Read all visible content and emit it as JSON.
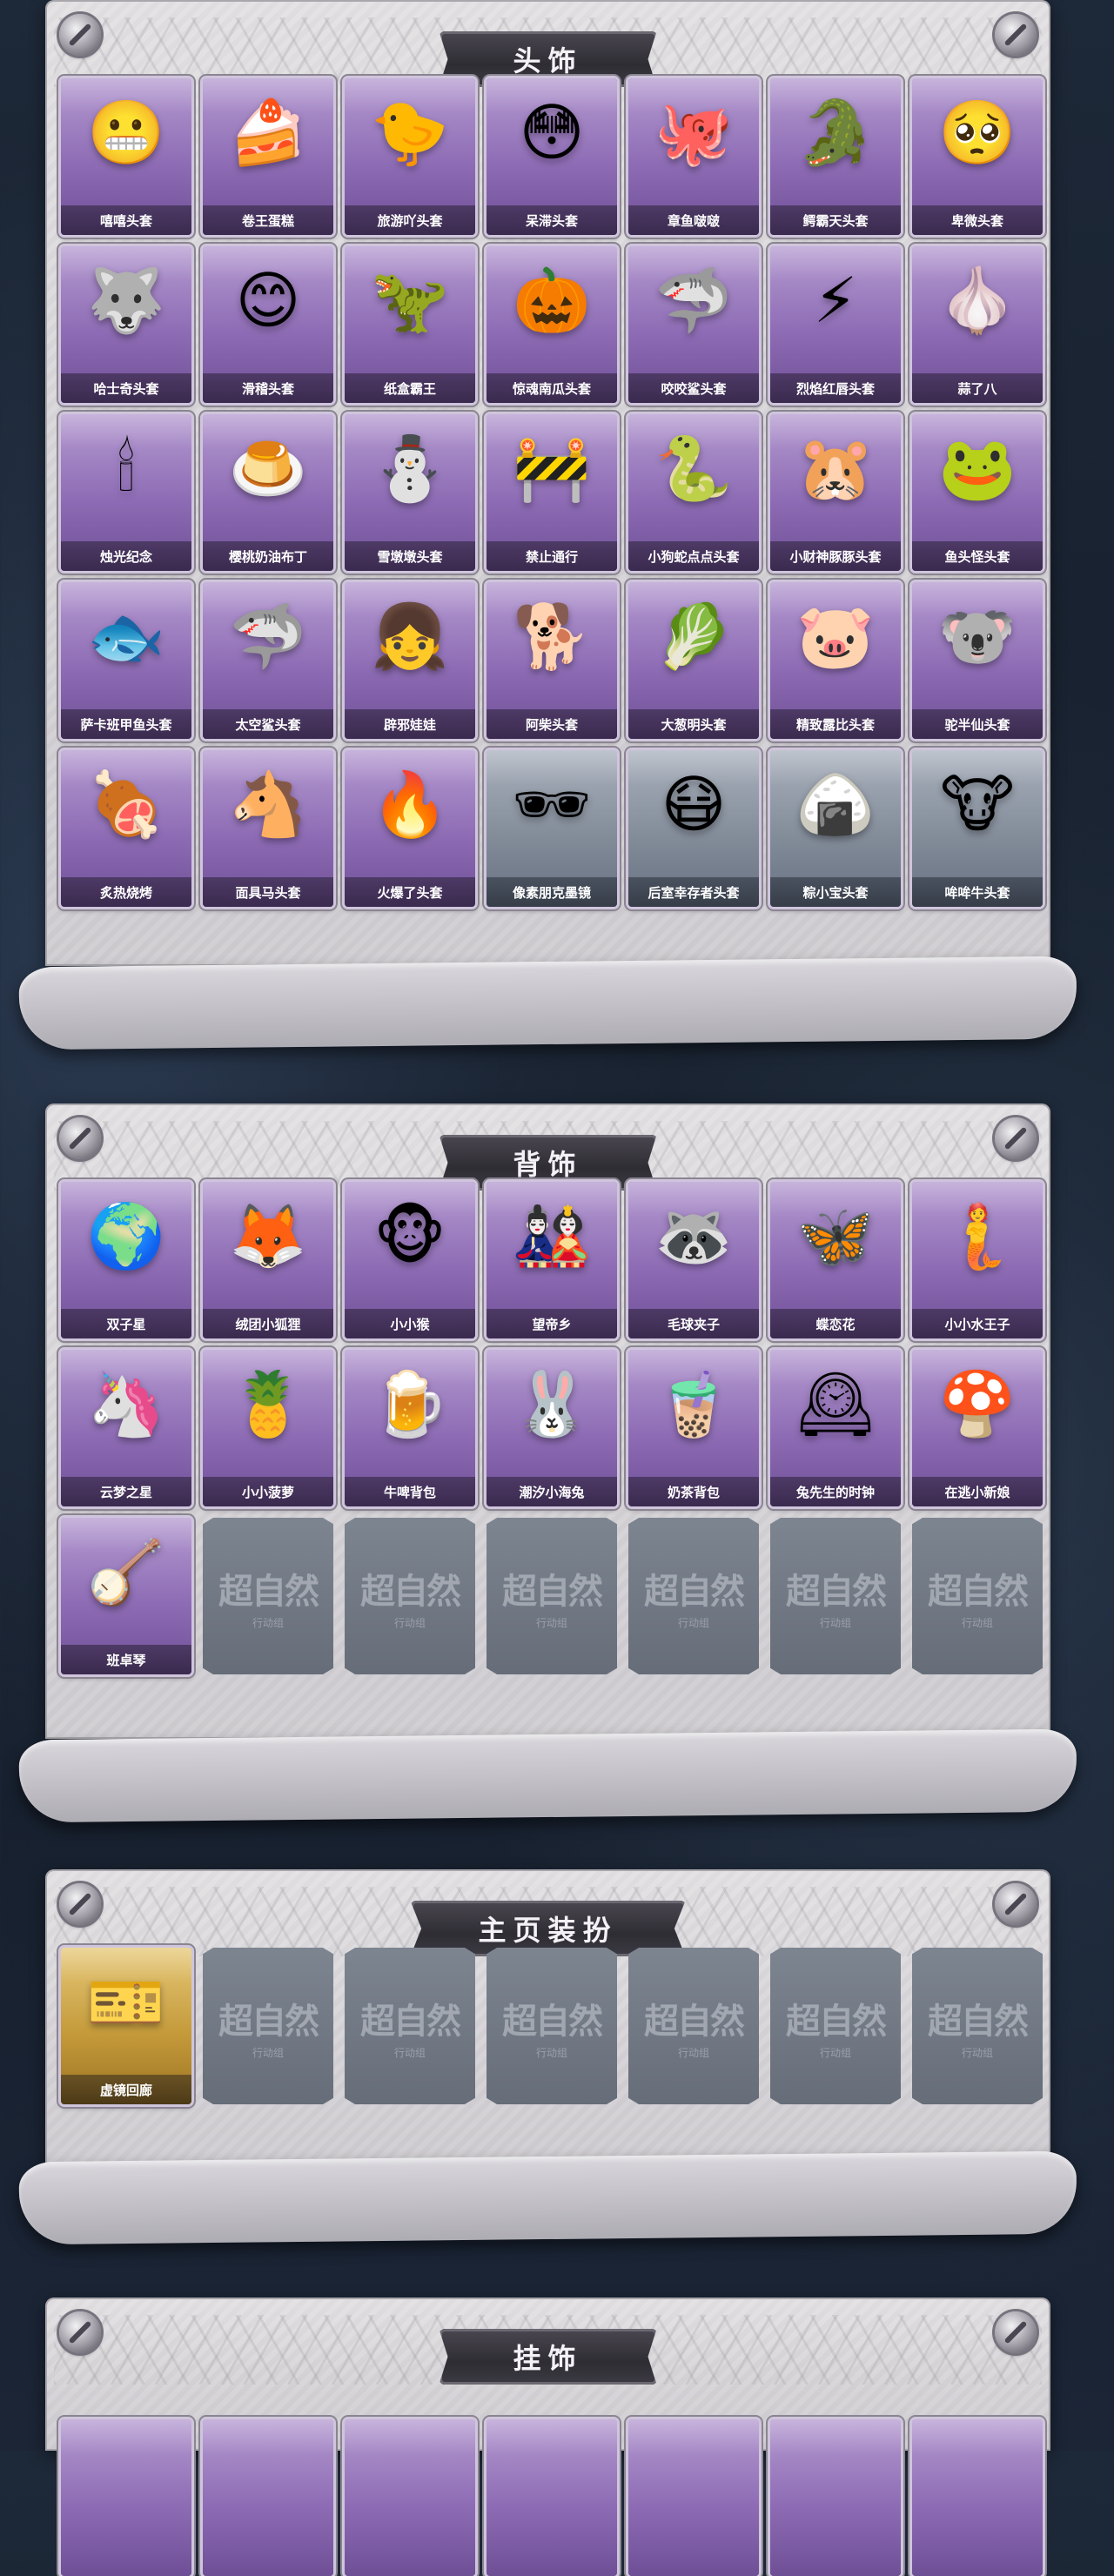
{
  "sections": [
    {
      "title": "头饰",
      "items": [
        {
          "name": "嘻嘻头套",
          "icon": "😬",
          "tone": "purple"
        },
        {
          "name": "卷王蛋糕",
          "icon": "🍰",
          "tone": "purple"
        },
        {
          "name": "旅游吖头套",
          "icon": "🐤",
          "tone": "purple"
        },
        {
          "name": "呆滞头套",
          "icon": "😳",
          "tone": "purple"
        },
        {
          "name": "章鱼啵啵",
          "icon": "🐙",
          "tone": "purple"
        },
        {
          "name": "鳄霸天头套",
          "icon": "🐊",
          "tone": "purple"
        },
        {
          "name": "卑微头套",
          "icon": "🥺",
          "tone": "purple"
        },
        {
          "name": "哈士奇头套",
          "icon": "🐺",
          "tone": "purple"
        },
        {
          "name": "滑稽头套",
          "icon": "😊",
          "tone": "purple"
        },
        {
          "name": "纸盒霸王",
          "icon": "🦖",
          "tone": "purple"
        },
        {
          "name": "惊魂南瓜头套",
          "icon": "🎃",
          "tone": "purple"
        },
        {
          "name": "咬咬鲨头套",
          "icon": "🦈",
          "tone": "purple"
        },
        {
          "name": "烈焰红唇头套",
          "icon": "⚡",
          "tone": "purple"
        },
        {
          "name": "蒜了八",
          "icon": "🧄",
          "tone": "purple"
        },
        {
          "name": "烛光纪念",
          "icon": "🕯",
          "tone": "purple"
        },
        {
          "name": "樱桃奶油布丁",
          "icon": "🍮",
          "tone": "purple"
        },
        {
          "name": "雪墩墩头套",
          "icon": "⛄",
          "tone": "purple"
        },
        {
          "name": "禁止通行",
          "icon": "🚧",
          "tone": "purple"
        },
        {
          "name": "小狗蛇点点头套",
          "icon": "🐍",
          "tone": "purple"
        },
        {
          "name": "小财神豚豚头套",
          "icon": "🐹",
          "tone": "purple"
        },
        {
          "name": "鱼头怪头套",
          "icon": "🐸",
          "tone": "purple"
        },
        {
          "name": "萨卡班甲鱼头套",
          "icon": "🐟",
          "tone": "purple"
        },
        {
          "name": "太空鲨头套",
          "icon": "🦈",
          "tone": "purple"
        },
        {
          "name": "辟邪娃娃",
          "icon": "👧",
          "tone": "purple"
        },
        {
          "name": "阿柴头套",
          "icon": "🐕",
          "tone": "purple"
        },
        {
          "name": "大葱明头套",
          "icon": "🥬",
          "tone": "purple"
        },
        {
          "name": "精致露比头套",
          "icon": "🐷",
          "tone": "purple"
        },
        {
          "name": "驼半仙头套",
          "icon": "🐨",
          "tone": "purple"
        },
        {
          "name": "炙热烧烤",
          "icon": "🍖",
          "tone": "purple"
        },
        {
          "name": "面具马头套",
          "icon": "🐴",
          "tone": "purple"
        },
        {
          "name": "火爆了头套",
          "icon": "🔥",
          "tone": "purple"
        },
        {
          "name": "像素朋克墨镜",
          "icon": "🕶",
          "tone": "grey"
        },
        {
          "name": "后室幸存者头套",
          "icon": "😷",
          "tone": "grey"
        },
        {
          "name": "粽小宝头套",
          "icon": "🍙",
          "tone": "grey"
        },
        {
          "name": "哞哞牛头套",
          "icon": "🐮",
          "tone": "grey"
        }
      ]
    },
    {
      "title": "背饰",
      "items": [
        {
          "name": "双子星",
          "icon": "🌍",
          "tone": "purple"
        },
        {
          "name": "绒团小狐狸",
          "icon": "🦊",
          "tone": "purple"
        },
        {
          "name": "小小猴",
          "icon": "🐵",
          "tone": "purple"
        },
        {
          "name": "望帝乡",
          "icon": "🎎",
          "tone": "purple"
        },
        {
          "name": "毛球夹子",
          "icon": "🦝",
          "tone": "purple"
        },
        {
          "name": "蝶恋花",
          "icon": "🦋",
          "tone": "purple"
        },
        {
          "name": "小小水王子",
          "icon": "🧜",
          "tone": "purple"
        },
        {
          "name": "云梦之星",
          "icon": "🦄",
          "tone": "purple"
        },
        {
          "name": "小小菠萝",
          "icon": "🍍",
          "tone": "purple"
        },
        {
          "name": "牛啤背包",
          "icon": "🍺",
          "tone": "purple"
        },
        {
          "name": "潮汐小海兔",
          "icon": "🐰",
          "tone": "purple"
        },
        {
          "name": "奶茶背包",
          "icon": "🧋",
          "tone": "purple"
        },
        {
          "name": "兔先生的时钟",
          "icon": "🕰",
          "tone": "purple"
        },
        {
          "name": "在逃小新娘",
          "icon": "🍄",
          "tone": "purple"
        },
        {
          "name": "班卓琴",
          "icon": "🪕",
          "tone": "purple"
        }
      ],
      "empty_slots": 6
    },
    {
      "title": "主页装扮",
      "items": [
        {
          "name": "虚镜回廊",
          "icon": "🎫",
          "tone": "gold"
        }
      ],
      "empty_slots": 6
    },
    {
      "title": "挂饰",
      "items": [],
      "empty_slots": 0
    }
  ],
  "placeholder": {
    "watermark": "超自然",
    "subtitle": "行动组"
  }
}
